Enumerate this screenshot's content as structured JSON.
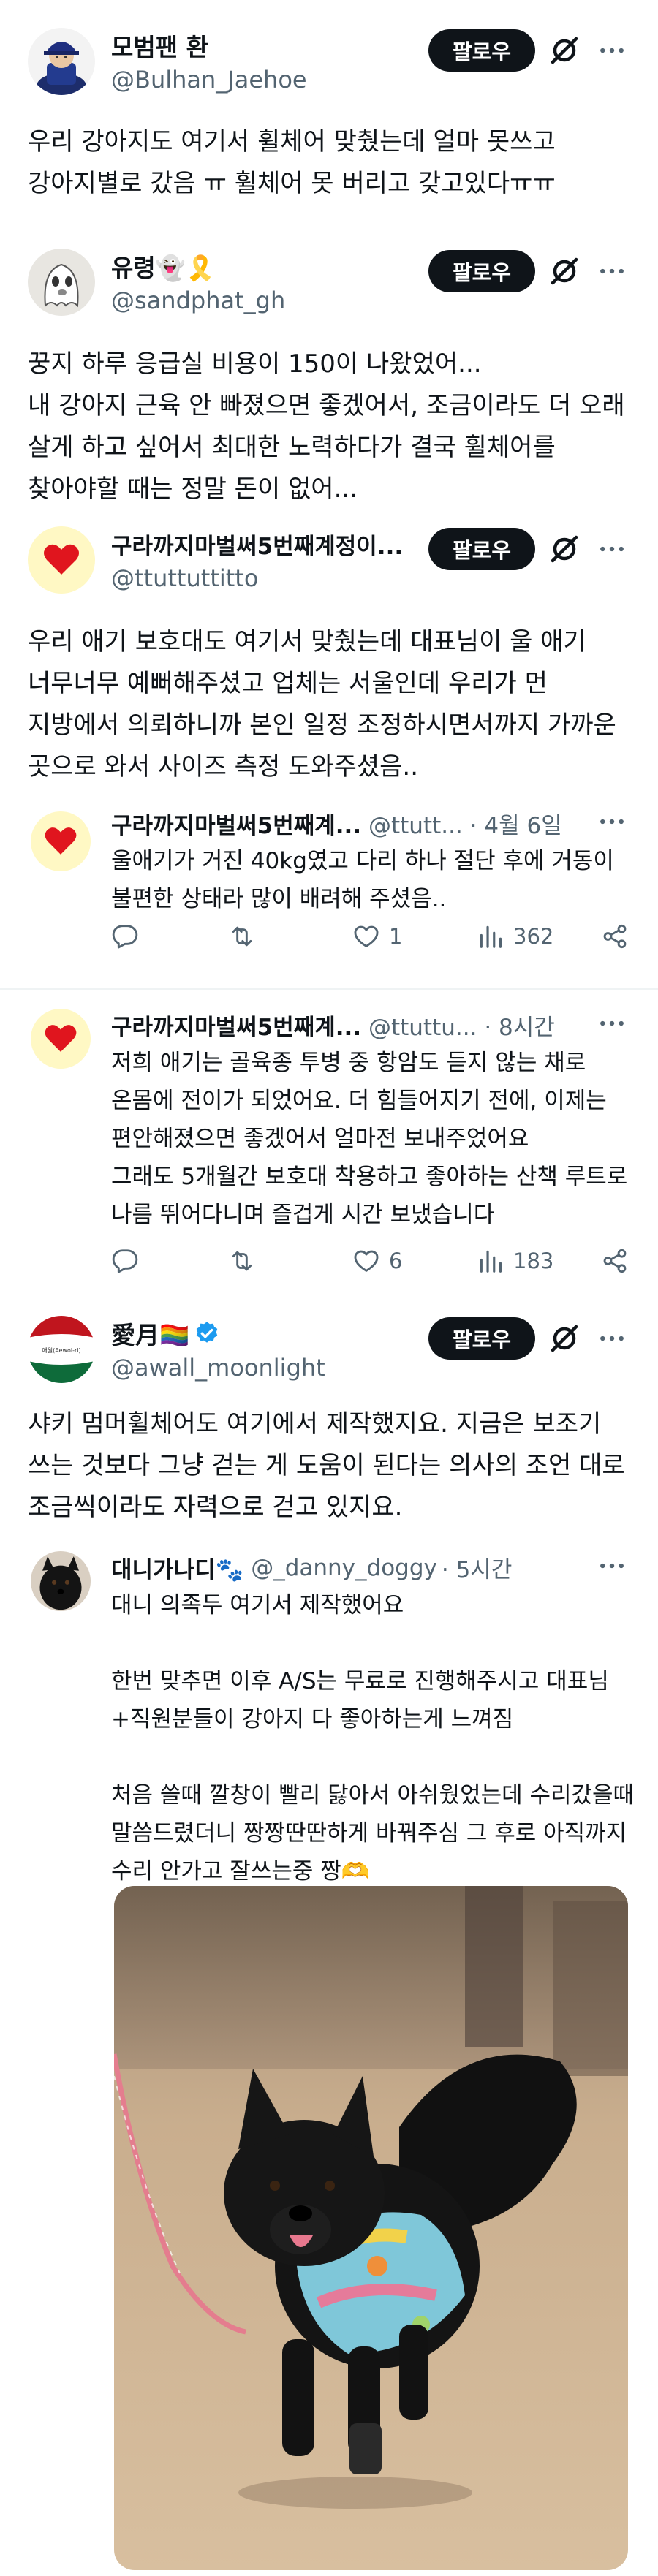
{
  "tweets": [
    {
      "name": "모범팬 환",
      "handle": "@Bulhan_Jaehoe",
      "follow": "팔로우",
      "text": "우리 강아지도 여기서 휠체어 맞췄는데 얼마 못쓰고\n강아지별로 갔음 ㅠ 휠체어 못 버리고 갖고있다ㅠㅠ"
    },
    {
      "name": "유령👻🎗️",
      "handle": "@sandphat_gh",
      "follow": "팔로우",
      "text": "꿍지 하루 응급실 비용이 150이 나왔었어...\n내 강아지 근육 안 빠졌으면 좋겠어서, 조금이라도 더 오래 살게 하고 싶어서 최대한 노력하다가 결국 휠체어를 찾아야할 때는 정말 돈이 없어..."
    },
    {
      "name": "구라까지마벌써5번째계정이...",
      "handle": "@ttuttuttitto",
      "follow": "팔로우",
      "text": "우리 애기 보호대도 여기서 맞췄는데 대표님이 울 애기 너무너무 예뻐해주셨고 업체는 서울인데 우리가 먼 지방에서 의뢰하니까 본인 일정 조정하시면서까지 가까운 곳으로 와서 사이즈 측정 도와주셨음.."
    },
    {
      "name": "구라까지마벌써5번째계...",
      "handle": "@ttutt...",
      "time": "· 4월 6일",
      "text": "울애기가 거진 40kg였고 다리 하나 절단 후에 거동이 불편한 상태라 많이 배려해 주셨음..",
      "stats": {
        "replies": "",
        "reposts": "",
        "likes": "1",
        "views": "362"
      }
    },
    {
      "name": "구라까지마벌써5번째계...",
      "handle": "@ttuttu...",
      "time": "· 8시간",
      "text": "저희 애기는 골육종 투병 중 항암도 듣지 않는 채로 온몸에 전이가 되었어요. 더 힘들어지기 전에, 이제는 편안해졌으면 좋겠어서 얼마전 보내주었어요\n그래도 5개월간 보호대 착용하고 좋아하는 산책 루트로 나름 뛰어다니며 즐겁게 시간 보냈습니다",
      "stats": {
        "replies": "",
        "reposts": "",
        "likes": "6",
        "views": "183"
      }
    },
    {
      "name": "愛月🏳️‍🌈",
      "handle": "@awall_moonlight",
      "follow": "팔로우",
      "avatar_text": "애월(Aewol-ri)",
      "text": "샤키 멈머휠체어도 여기에서 제작했지요. 지금은 보조기 쓰는 것보다 그냥 걷는 게 도움이 된다는 의사의 조언 대로 조금씩이라도 자력으로 걷고 있지요."
    },
    {
      "name": "대니가나디🐾",
      "handle": "@_danny_doggy",
      "time": "· 5시간",
      "text": "대니 의족두 여기서 제작했어요\n\n한번 맞추면 이후 A/S는 무료로 진행해주시고 대표님+직원분들이 강아지 다 좋아하는게 느껴짐\n\n처음 쓸때 깔창이 빨리 닳아서 아쉬웠었는데 수리갔을때 말씀드렸더니 짱짱딴딴하게 바꿔주심 그 후로 아직까지 수리 안가고 잘쓰는중 짱🫶"
    }
  ],
  "colors": {
    "text": "#0f1419",
    "secondary": "#536471",
    "verified": "#1d9bf0",
    "follow_bg": "#0f1419",
    "divider": "#eff3f4"
  },
  "icons": [
    "grok-icon",
    "more-icon",
    "reply-icon",
    "repost-icon",
    "like-icon",
    "views-icon",
    "share-icon",
    "verified-badge-icon"
  ]
}
